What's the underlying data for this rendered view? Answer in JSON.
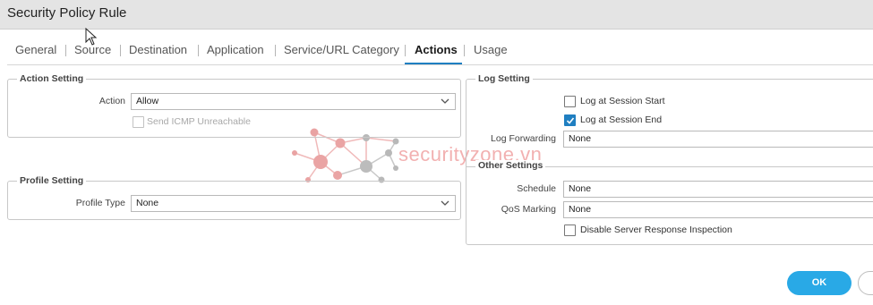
{
  "window": {
    "title": "Security Policy Rule"
  },
  "tabs": [
    {
      "label": "General"
    },
    {
      "label": "Source"
    },
    {
      "label": "Destination"
    },
    {
      "label": "Application"
    },
    {
      "label": "Service/URL Category"
    },
    {
      "label": "Actions",
      "active": true
    },
    {
      "label": "Usage"
    }
  ],
  "action_setting": {
    "legend": "Action Setting",
    "action_label": "Action",
    "action_value": "Allow",
    "send_icmp_label": "Send ICMP Unreachable",
    "send_icmp_checked": false
  },
  "profile_setting": {
    "legend": "Profile Setting",
    "profile_type_label": "Profile Type",
    "profile_type_value": "None"
  },
  "log_setting": {
    "legend": "Log Setting",
    "log_start_label": "Log at Session Start",
    "log_start_checked": false,
    "log_end_label": "Log at Session End",
    "log_end_checked": true,
    "log_forwarding_label": "Log Forwarding",
    "log_forwarding_value": "None"
  },
  "other_settings": {
    "legend": "Other Settings",
    "schedule_label": "Schedule",
    "schedule_value": "None",
    "qos_label": "QoS Marking",
    "qos_value": "None",
    "disable_sri_label": "Disable Server Response Inspection",
    "disable_sri_checked": false
  },
  "footer": {
    "ok_label": "OK"
  },
  "watermark": {
    "text": "securityzone.vn"
  },
  "colors": {
    "accent": "#1f7fc1",
    "ok_button": "#29a9e6",
    "watermark": "#f2b1b1"
  }
}
